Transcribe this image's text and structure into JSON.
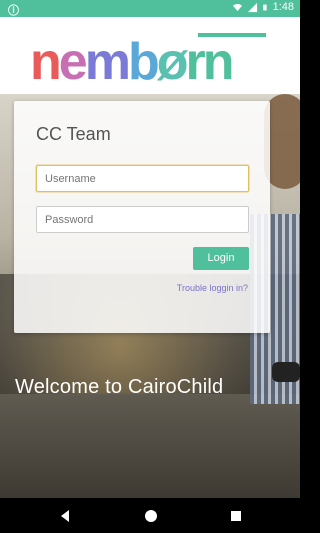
{
  "status_bar": {
    "left_text": "ⓘ",
    "time": "1:48",
    "icons": [
      "wifi-icon",
      "signal-icon",
      "battery-icon"
    ]
  },
  "logo": {
    "letters": [
      "n",
      "e",
      "m",
      "b",
      "ø",
      "r",
      "n"
    ],
    "colors": [
      "#ea5a5a",
      "#c86fb4",
      "#7b7ad6",
      "#5aa8d8",
      "#5ac0b0",
      "#4fbf9c",
      "#4fbf9c"
    ]
  },
  "login": {
    "title": "CC Team",
    "username_placeholder": "Username",
    "password_placeholder": "Password",
    "login_label": "Login",
    "trouble_label": "Trouble loggin in?"
  },
  "welcome_text": "Welcome to CairoChild",
  "nav": {
    "back_icon": "back-triangle-icon",
    "home_icon": "home-circle-icon",
    "recent_icon": "recent-square-icon"
  },
  "theme": {
    "accent": "#4fbf9c",
    "link": "#7a72c8"
  }
}
